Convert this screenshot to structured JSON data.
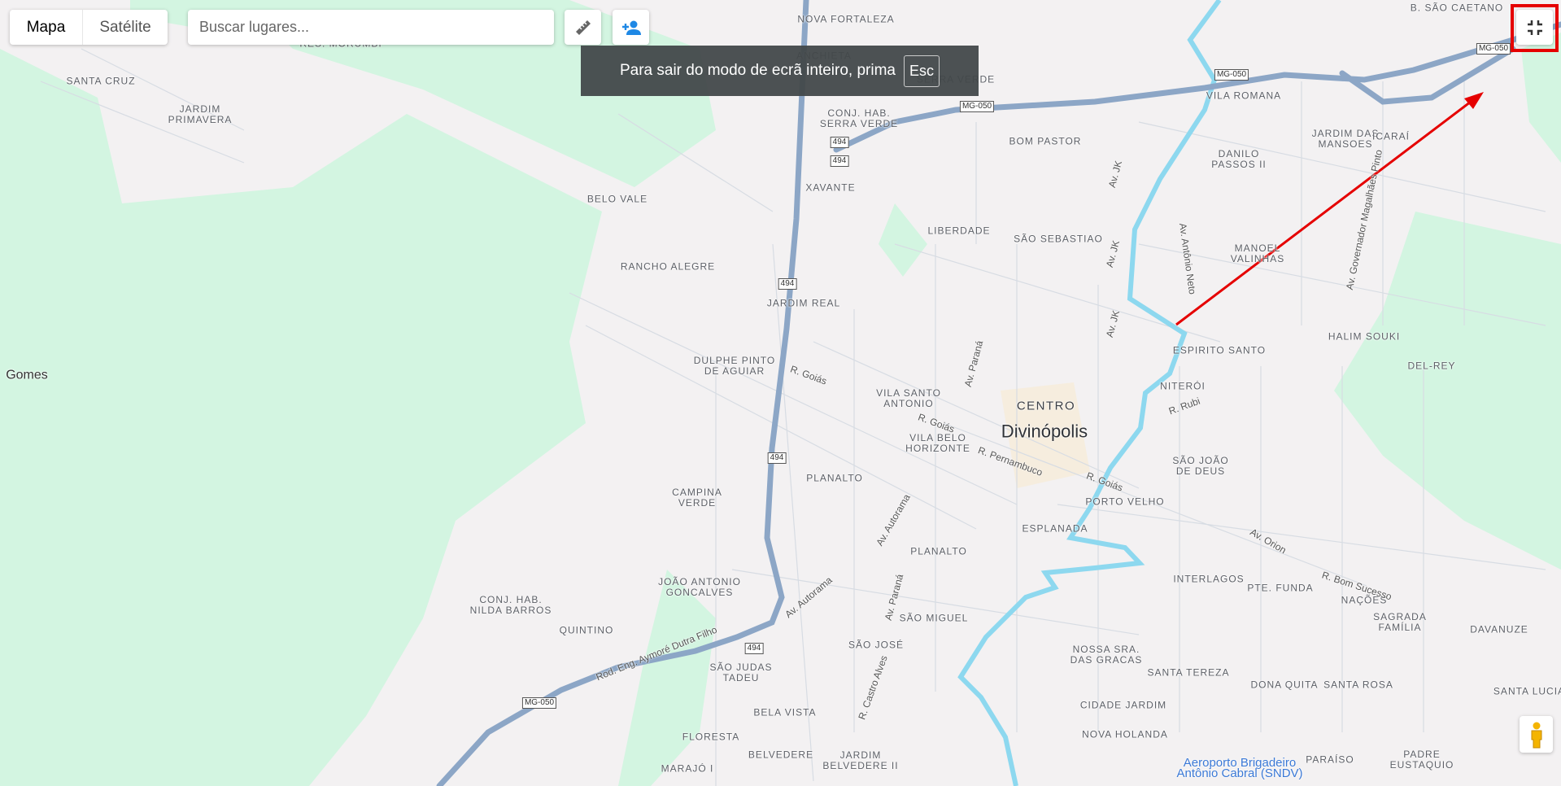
{
  "map_type": {
    "options": [
      "Mapa",
      "Satélite"
    ],
    "selected": "Mapa"
  },
  "search": {
    "placeholder": "Buscar lugares...",
    "value": ""
  },
  "toolbar": {
    "ruler_icon": "ruler-icon",
    "add_person_icon": "person-add-icon"
  },
  "fullscreen_toast": {
    "message": "Para sair do modo de ecrã inteiro, prima",
    "key": "Esc"
  },
  "controls": {
    "exit_fullscreen_icon": "fullscreen-exit-icon",
    "pegman_icon": "pegman-icon"
  },
  "colors": {
    "land": "#f3f1f2",
    "green": "#d3f5e1",
    "highway": "#8ca6c6",
    "river": "#8dd8ef",
    "annotation": "#e50000",
    "accent": "#1a73e8"
  },
  "map": {
    "neighborhoods": [
      "NOVA FORTALEZA",
      "ANCHIETA",
      "RES. MORUMBI",
      "SANTA CRUZ",
      "JARDIM\nPRIMAVERA",
      "SERRA VERDE",
      "CONJ. HAB.\nSERRA VERDE",
      "VILA ROMANA",
      "B. SÃO CAETANO",
      "JARDIM DAS\nMANSOES",
      "ICARAÍ",
      "BOM PASTOR",
      "DANILO\nPASSOS II",
      "XAVANTE",
      "BELO VALE",
      "LIBERDADE",
      "SÃO SEBASTIAO",
      "MANOEL\nVALINHAS",
      "RANCHO ALEGRE",
      "JARDIM REAL",
      "HALIM SOUKI",
      "DEL-REY",
      "ESPIRITO SANTO",
      "DULPHE PINTO\nDE AGUIAR",
      "NITERÓI",
      "VILA SANTO\nANTONIO",
      "VILA BELO\nHORIZONTE",
      "SÃO JOÃO\nDE DEUS",
      "PLANALTO",
      "PORTO VELHO",
      "CAMPINA\nVERDE",
      "ESPLANADA",
      "PLANALTO",
      "INTERLAGOS",
      "PTE. FUNDA",
      "NAÇÕES",
      "SAGRADA\nFAMÍLIA",
      "DAVANUZE",
      "JOÃO ANTONIO\nGONCALVES",
      "CONJ. HAB.\nNILDA BARROS",
      "QUINTINO",
      "SÃO MIGUEL",
      "SÃO JOSÉ",
      "NOSSA SRA.\nDAS GRACAS",
      "SANTA TEREZA",
      "DONA QUITA",
      "SANTA ROSA",
      "SÃO JUDAS\nTADEU",
      "BELA VISTA",
      "CIDADE JARDIM",
      "NOVA HOLANDA",
      "FLORESTA",
      "BELVEDERE",
      "JARDIM\nBELVEDERE II",
      "PARAÍSO",
      "PADRE\nEUSTAQUIO",
      "MARAJÓ I",
      "SANTA LUCIA"
    ],
    "district": "CENTRO",
    "city": "Divinópolis",
    "place": "Gomes",
    "airport": "Aeroporto Brigadeiro\nAntônio Cabral (SNDV)",
    "streets": [
      "Av. JK",
      "Av. JK",
      "Av. JK",
      "Av. Antônio Neto",
      "Av. Governador Magalhães Pinto",
      "Av. Paraná",
      "R. Goiás",
      "R. Goiás",
      "R. Pernambuco",
      "R. Goiás",
      "R. Rubi",
      "Av. Orion",
      "R. Bom Sucesso",
      "Av. Autorama",
      "Av. Autorama",
      "Av. Paraná",
      "R. Castro Alves",
      "Rod. Eng. Aymoré Dutra Filho"
    ],
    "shields": [
      "494",
      "494",
      "494",
      "494",
      "494",
      "MG-050",
      "MG-050",
      "MG-050",
      "MG-050"
    ]
  }
}
